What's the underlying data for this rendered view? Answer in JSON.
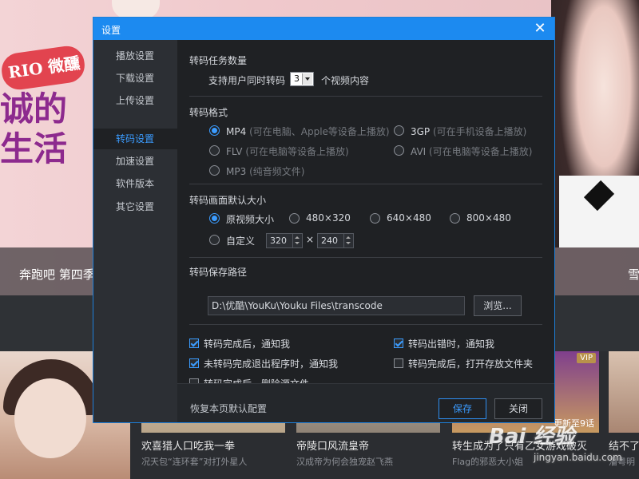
{
  "background": {
    "hero_title": "奔跑吧 第四季",
    "hero_title_right": "雪",
    "rio_logo": "RIO 微醺",
    "show_art_text": "诚的生活",
    "cards": [
      {
        "title": "欢喜猎人口吃我一拳",
        "subtitle": "况天包“连环套”对打外星人"
      },
      {
        "title": "帝陵口风流皇帝",
        "subtitle": "汉成帝为何会独宠赵飞燕"
      },
      {
        "title": "转生成为了只有乙女游戏破灭",
        "subtitle": "Flag的邪恶大小姐",
        "badge": "VIP",
        "episodes": "更新至9话"
      },
      {
        "title": "结不了",
        "subtitle": "潘粤明"
      }
    ]
  },
  "watermark": {
    "text": "Bai 经验",
    "sub": "jingyan.baidu.com"
  },
  "dialog": {
    "title": "设置",
    "close_glyph": "✕",
    "sidebar": [
      {
        "label": "播放设置"
      },
      {
        "label": "下载设置"
      },
      {
        "label": "上传设置"
      },
      {
        "label": "转码设置",
        "active": true
      },
      {
        "label": "加速设置"
      },
      {
        "label": "软件版本"
      },
      {
        "label": "其它设置"
      }
    ],
    "task_count": {
      "title": "转码任务数量",
      "prefix": "支持用户同时转码",
      "value": "3",
      "suffix": "个视频内容"
    },
    "format": {
      "title": "转码格式",
      "options": [
        {
          "label": "MP4",
          "hint": "(可在电脑、Apple等设备上播放)",
          "selected": true
        },
        {
          "label": "3GP",
          "hint": "(可在手机设备上播放)"
        },
        {
          "label": "FLV",
          "hint": "(可在电脑等设备上播放)"
        },
        {
          "label": "AVI",
          "hint": "(可在电脑等设备上播放)"
        },
        {
          "label": "MP3",
          "hint": "(纯音频文件)"
        }
      ]
    },
    "size": {
      "title": "转码画面默认大小",
      "options": [
        {
          "label": "原视频大小",
          "selected": true
        },
        {
          "label": "480×320"
        },
        {
          "label": "640×480"
        },
        {
          "label": "800×480"
        }
      ],
      "custom_label": "自定义",
      "custom_width": "320",
      "times": "×",
      "custom_height": "240"
    },
    "path": {
      "title": "转码保存路径",
      "value": "D:\\优酷\\YouKu\\Youku Files\\transcode",
      "browse": "浏览..."
    },
    "notifications": [
      {
        "label": "转码完成后，通知我",
        "checked": true
      },
      {
        "label": "转码出错时，通知我",
        "checked": true
      },
      {
        "label": "未转码完成退出程序时，通知我",
        "checked": true
      },
      {
        "label": "转码完成后，打开存放文件夹",
        "checked": false
      },
      {
        "label": "转码完成后，删除源文件",
        "checked": false
      }
    ],
    "footer": {
      "reset": "恢复本页默认配置",
      "save": "保存",
      "close": "关闭"
    }
  },
  "colors": {
    "accent": "#1c8af0",
    "dialog_bg": "#1f2124",
    "sidebar_bg": "#2c2f34",
    "active_text": "#3b9cff"
  }
}
